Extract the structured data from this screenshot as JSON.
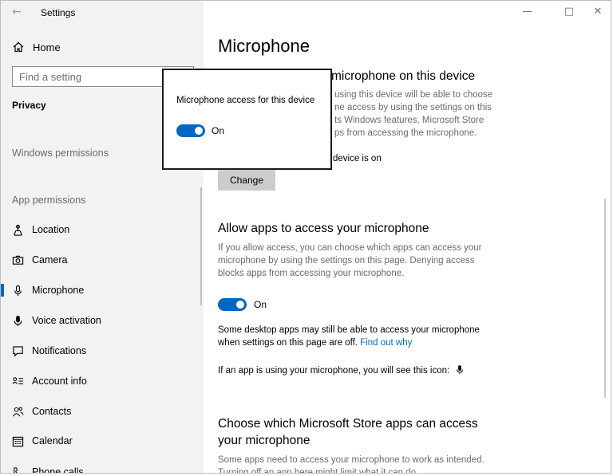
{
  "window": {
    "title": "Settings"
  },
  "sidebar": {
    "home_label": "Home",
    "search_placeholder": "Find a setting",
    "section_title": "Privacy",
    "group_windows": "Windows permissions",
    "group_app": "App permissions",
    "items": [
      {
        "label": "Location",
        "icon": "location-icon"
      },
      {
        "label": "Camera",
        "icon": "camera-icon"
      },
      {
        "label": "Microphone",
        "icon": "microphone-icon"
      },
      {
        "label": "Voice activation",
        "icon": "voice-activation-icon"
      },
      {
        "label": "Notifications",
        "icon": "notifications-icon"
      },
      {
        "label": "Account info",
        "icon": "account-info-icon"
      },
      {
        "label": "Contacts",
        "icon": "contacts-icon"
      },
      {
        "label": "Calendar",
        "icon": "calendar-icon"
      },
      {
        "label": "Phone calls",
        "icon": "phone-calls-icon"
      }
    ],
    "active_item": "Microphone"
  },
  "main": {
    "title": "Microphone",
    "device_section": {
      "heading_visible": "microphone on this device",
      "lines": [
        "using this device will be able to choose",
        "ne access by using the settings on this",
        "ts Windows features, Microsoft Store",
        "ps from accessing the microphone."
      ],
      "status_visible": "device is on",
      "change_label": "Change"
    },
    "apps_section": {
      "heading": "Allow apps to access your microphone",
      "lines": [
        "If you allow access, you can choose which apps can access your",
        "microphone by using the settings on this page. Denying access",
        "blocks apps from accessing your microphone."
      ],
      "toggle_label": "On",
      "desktop_line1": "Some desktop apps may still be able to access your microphone",
      "desktop_line2": "when settings on this page are off.",
      "find_out_why": "Find out why",
      "icon_note": "If an app is using your microphone, you will see this icon:"
    },
    "store_section": {
      "heading_line1": "Choose which Microsoft Store apps can access",
      "heading_line2": "your microphone",
      "line1": "Some apps need to access your microphone to work as intended.",
      "line2_partial": "Turning off an app here might limit what it can do."
    }
  },
  "popup": {
    "text": "Microphone access for this device",
    "toggle_label": "On"
  },
  "colors": {
    "accent": "#0067c0",
    "sidebar_bg": "#f2f2f2"
  }
}
